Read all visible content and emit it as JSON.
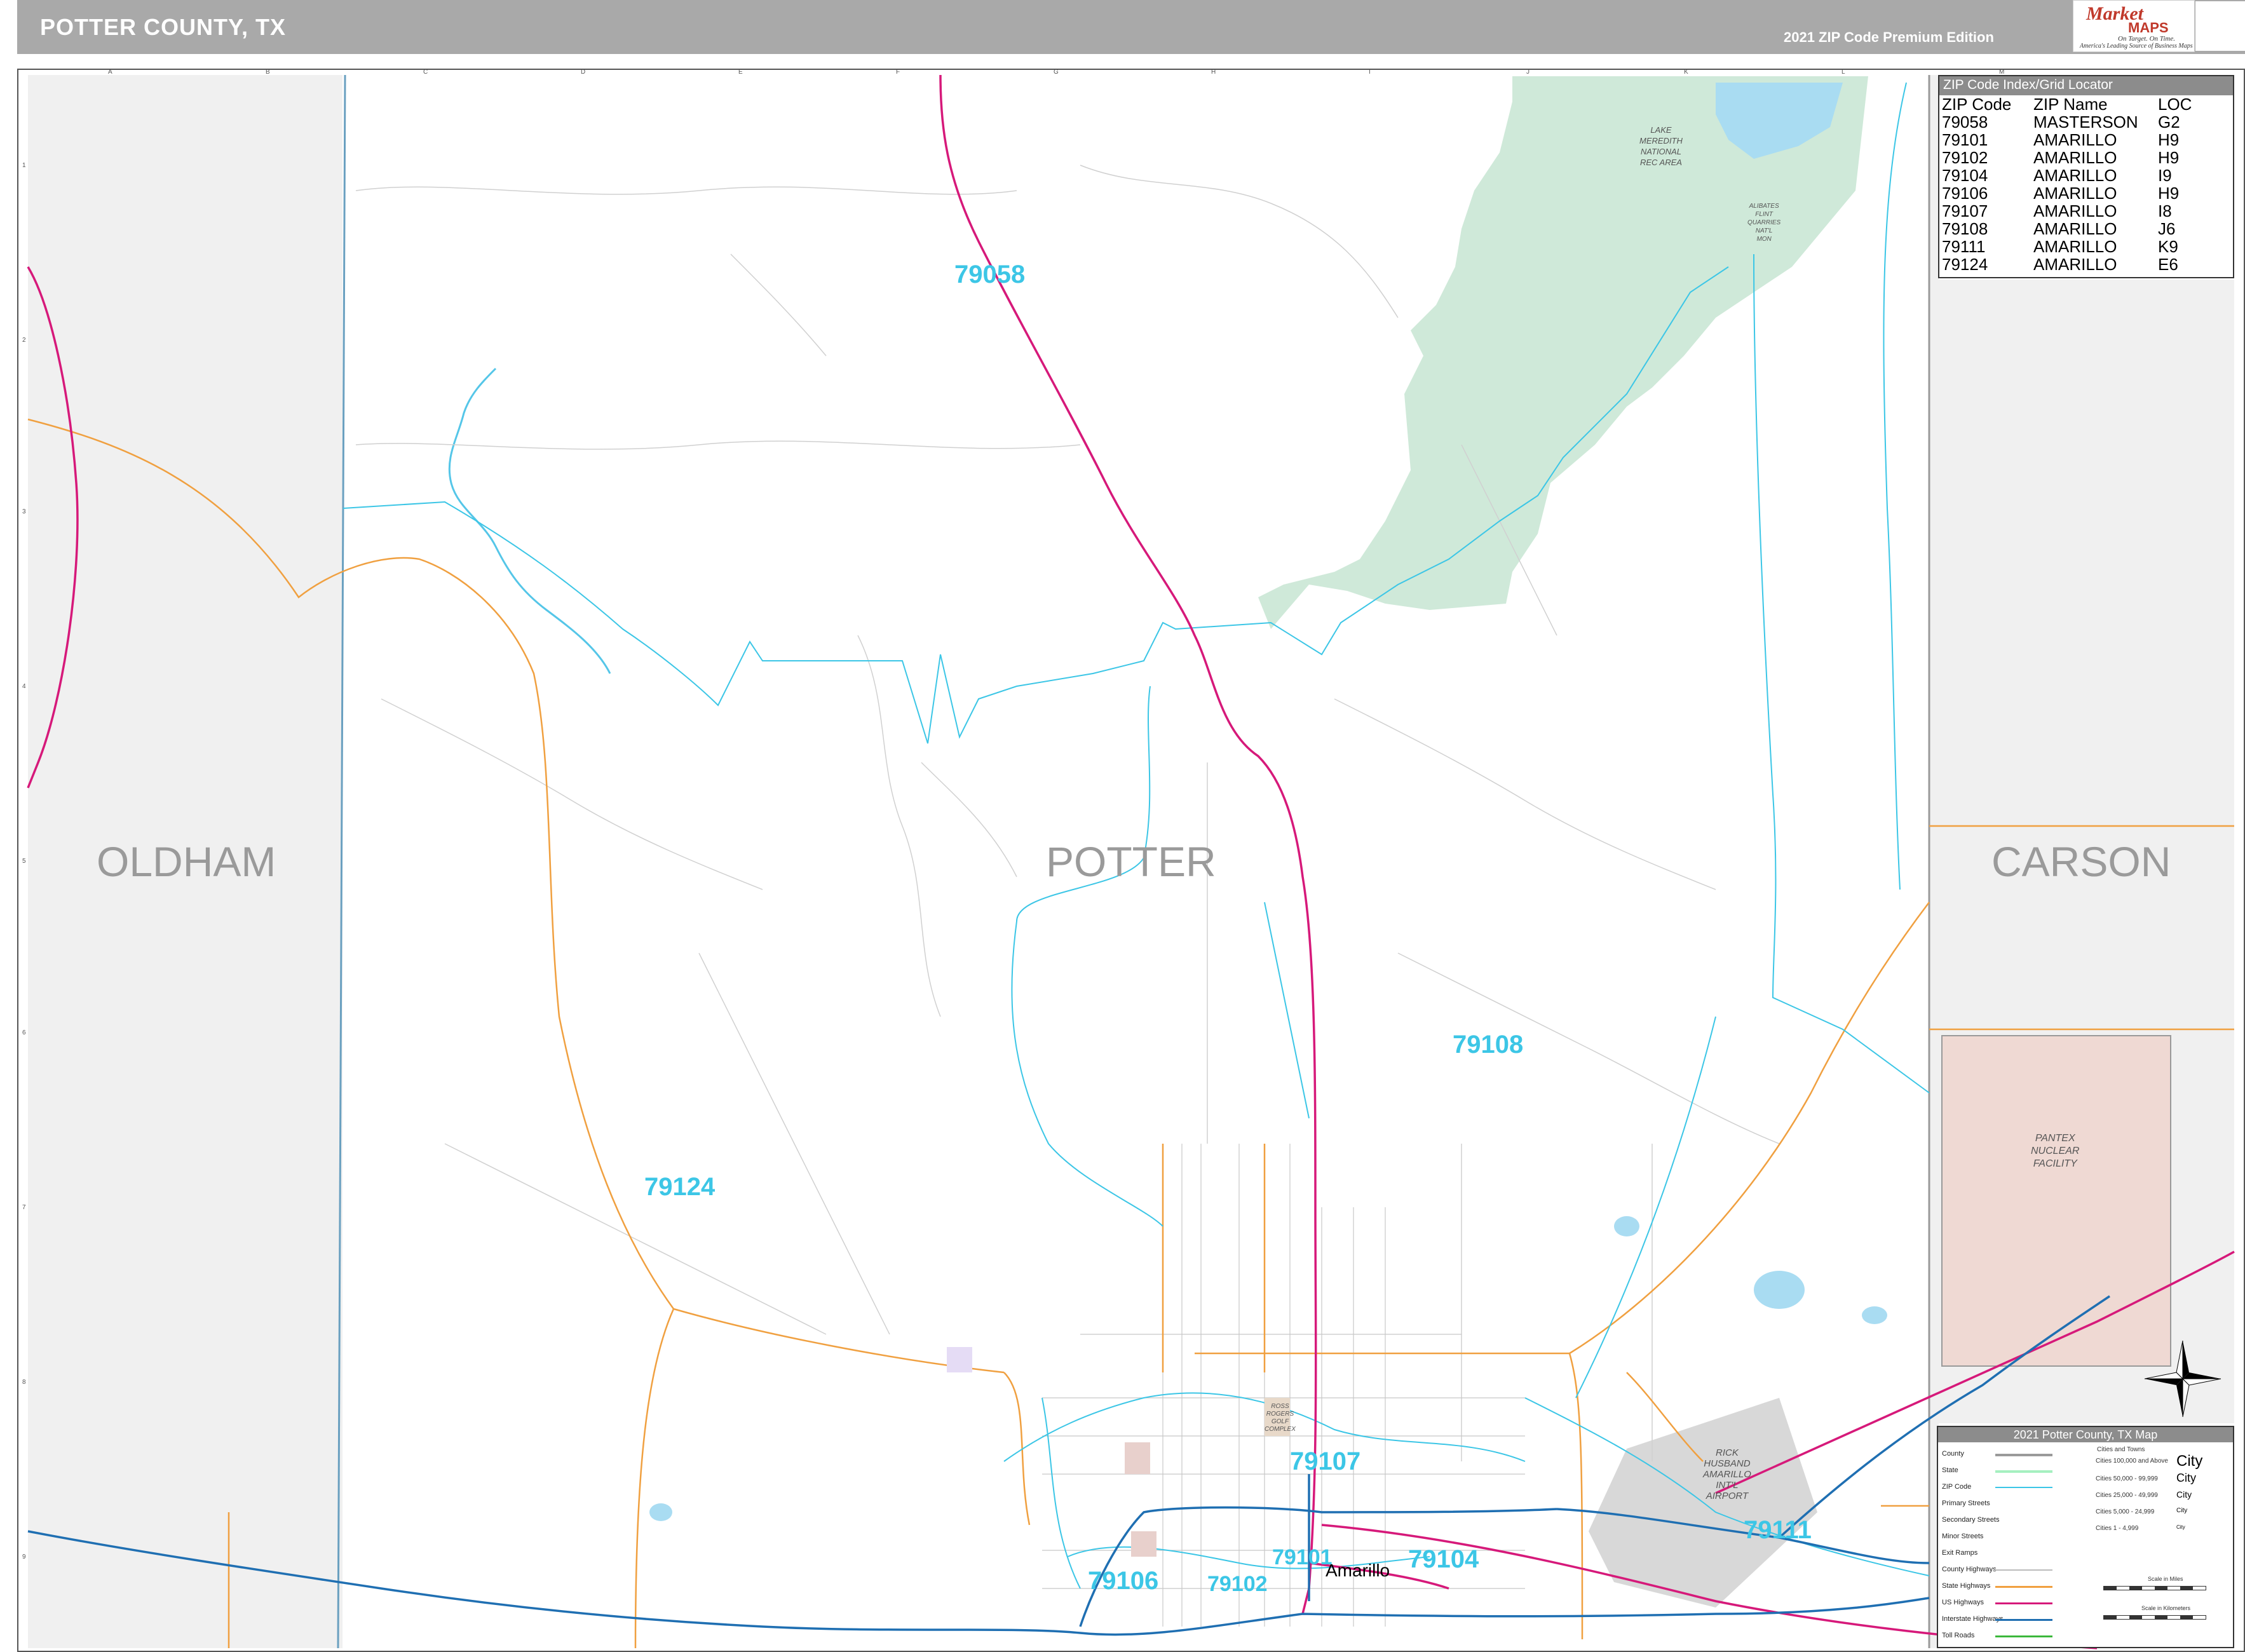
{
  "header": {
    "title": "POTTER COUNTY, TX",
    "edition": "2021 ZIP Code Premium Edition"
  },
  "logo": {
    "brand_top": "Market",
    "brand_bottom": "MAPS",
    "tagline1": "On Target.  On Time.",
    "tagline2": "America's Leading Source of Business Maps"
  },
  "counties": {
    "west": "OLDHAM",
    "center": "POTTER",
    "east": "CARSON"
  },
  "zip_labels": [
    "79058",
    "79124",
    "79108",
    "79107",
    "79111",
    "79104",
    "79101",
    "79102",
    "79106"
  ],
  "city": "Amarillo",
  "places": {
    "lake": [
      "LAKE",
      "MEREDITH",
      "NATIONAL",
      "REC AREA"
    ],
    "alibates": [
      "ALIBATES",
      "FLINT",
      "QUARRIES",
      "NAT'L",
      "MON"
    ],
    "pantex": [
      "PANTEX",
      "NUCLEAR",
      "FACILITY"
    ],
    "airport": [
      "RICK",
      "HUSBAND",
      "AMARILLO",
      "INT'L",
      "AIRPORT"
    ],
    "golf": [
      "ROSS",
      "ROGERS",
      "GOLF",
      "COMPLEX"
    ]
  },
  "grid": {
    "columns": [
      "A",
      "B",
      "C",
      "D",
      "E",
      "F",
      "G",
      "H",
      "I",
      "J",
      "K",
      "L",
      "M"
    ],
    "rows": [
      "1",
      "2",
      "3",
      "4",
      "5",
      "6",
      "7",
      "8",
      "9"
    ]
  },
  "zip_index": {
    "title": "ZIP Code Index/Grid Locator",
    "headers": [
      "ZIP Code",
      "ZIP Name",
      "LOC"
    ],
    "rows": [
      [
        "79058",
        "MASTERSON",
        "G2"
      ],
      [
        "79101",
        "AMARILLO",
        "H9"
      ],
      [
        "79102",
        "AMARILLO",
        "H9"
      ],
      [
        "79104",
        "AMARILLO",
        "I9"
      ],
      [
        "79106",
        "AMARILLO",
        "H9"
      ],
      [
        "79107",
        "AMARILLO",
        "I8"
      ],
      [
        "79108",
        "AMARILLO",
        "J6"
      ],
      [
        "79111",
        "AMARILLO",
        "K9"
      ],
      [
        "79124",
        "AMARILLO",
        "E6"
      ]
    ]
  },
  "legend": {
    "title": "2021 Potter County, TX Map",
    "items": [
      "County",
      "State",
      "ZIP Code",
      "Primary Streets",
      "Secondary Streets",
      "Minor Streets",
      "Exit Ramps",
      "County Highways",
      "State Highways",
      "US Highways",
      "Interstate Highways",
      "Toll Roads"
    ],
    "cities_header": "Cities and Towns",
    "city_tiers": [
      "Cities 100,000 and Above",
      "Cities 50,000 - 99,999",
      "Cities 25,000 - 49,999",
      "Cities 5,000 - 24,999",
      "Cities 1 - 4,999"
    ],
    "city_samples": [
      "City",
      "City",
      "City",
      "City",
      "City"
    ],
    "scale_miles": "Scale in Miles",
    "scale_km": "Scale in Kilometers"
  },
  "colors": {
    "header_bg": "#a9a9a9",
    "zip_line": "#3cc6e6",
    "us_highway": "#d6197a",
    "interstate": "#1f6fb2",
    "state_highway": "#f0a040",
    "park": "#cfe9d9",
    "pantex": "#efd9d3",
    "outside_county": "#f0f0f0",
    "water": "#a9dcf2"
  }
}
